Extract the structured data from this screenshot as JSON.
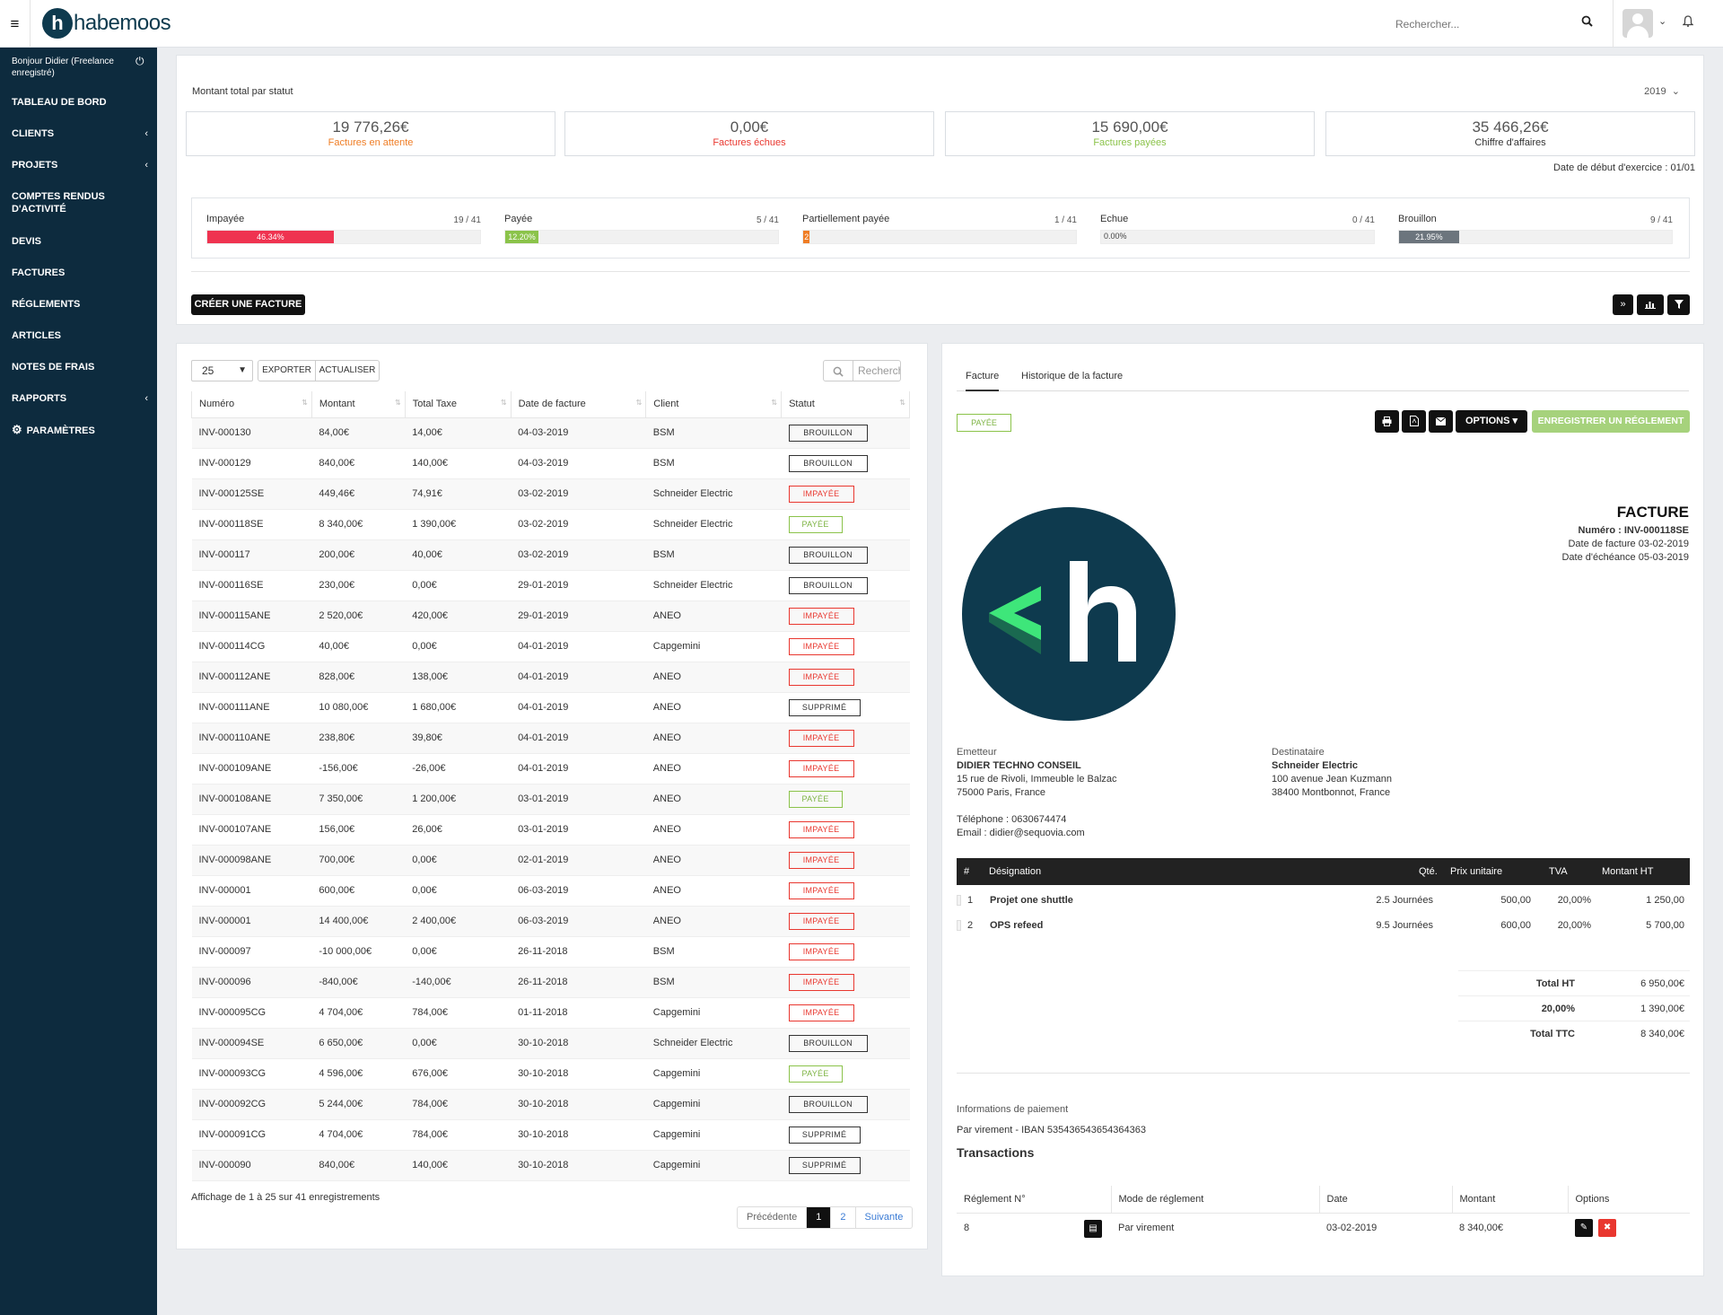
{
  "app": {
    "logo_letter": "h",
    "logo_text": "habemoos",
    "brand_color": "#0e3a4e"
  },
  "header": {
    "menu_icon": "hamburger-icon",
    "search_placeholder": "Rechercher..."
  },
  "sidebar": {
    "greeting": "Bonjour Didier (Freelance enregistré)",
    "items": [
      {
        "label": "TABLEAU DE BORD",
        "arrow": ""
      },
      {
        "label": "CLIENTS",
        "arrow": "‹"
      },
      {
        "label": "PROJETS",
        "arrow": "‹"
      },
      {
        "label": "COMPTES RENDUS D'ACTIVITÉ",
        "arrow": ""
      },
      {
        "label": "DEVIS",
        "arrow": ""
      },
      {
        "label": "FACTURES",
        "arrow": ""
      },
      {
        "label": "RÉGLEMENTS",
        "arrow": ""
      },
      {
        "label": "ARTICLES",
        "arrow": ""
      },
      {
        "label": "NOTES DE FRAIS",
        "arrow": ""
      },
      {
        "label": "RAPPORTS",
        "arrow": "‹"
      },
      {
        "label": "PARAMÈTRES",
        "arrow": ""
      }
    ]
  },
  "stats": {
    "title": "Montant total par statut",
    "year": "2019",
    "kpis": [
      {
        "value": "19 776,26€",
        "label": "Factures en attente",
        "color": "#ef7d25"
      },
      {
        "value": "0,00€",
        "label": "Factures échues",
        "color": "#e9372f"
      },
      {
        "value": "15 690,00€",
        "label": "Factures payées",
        "color": "#8bc34a"
      },
      {
        "value": "35 466,26€",
        "label": "Chiffre d'affaires",
        "color": "#333333"
      }
    ],
    "fiscal_year": "Date de début d'exercice : 01/01",
    "progress": [
      {
        "label": "Impayée",
        "count": "19 / 41",
        "pct": 46.34,
        "text": "46.34%",
        "color": "#ef3350"
      },
      {
        "label": "Payée",
        "count": "5 / 41",
        "pct": 12.2,
        "text": "12.20%",
        "color": "#8bc34a"
      },
      {
        "label": "Partiellement payée",
        "count": "1 / 41",
        "pct": 2.44,
        "text": "2",
        "color": "#ef7d25"
      },
      {
        "label": "Echue",
        "count": "0 / 41",
        "pct": 0,
        "text": "0.00%",
        "color": "#777777"
      },
      {
        "label": "Brouillon",
        "count": "9 / 41",
        "pct": 21.95,
        "text": "21.95%",
        "color": "#6c757d"
      }
    ],
    "create_label": "CRÉER UNE FACTURE"
  },
  "list": {
    "page_size": "25",
    "export_label": "EXPORTER",
    "refresh_label": "ACTUALISER",
    "search_placeholder": "Recherche",
    "columns": [
      "Numéro",
      "Montant",
      "Total Taxe",
      "Date de facture",
      "Client",
      "Statut"
    ],
    "rows": [
      [
        "INV-000130",
        "84,00€",
        "14,00€",
        "04-03-2019",
        "BSM",
        "BROUILLON"
      ],
      [
        "INV-000129",
        "840,00€",
        "140,00€",
        "04-03-2019",
        "BSM",
        "BROUILLON"
      ],
      [
        "INV-000125SE",
        "449,46€",
        "74,91€",
        "03-02-2019",
        "Schneider Electric",
        "IMPAYÉE"
      ],
      [
        "INV-000118SE",
        "8 340,00€",
        "1 390,00€",
        "03-02-2019",
        "Schneider Electric",
        "PAYÉE"
      ],
      [
        "INV-000117",
        "200,00€",
        "40,00€",
        "03-02-2019",
        "BSM",
        "BROUILLON"
      ],
      [
        "INV-000116SE",
        "230,00€",
        "0,00€",
        "29-01-2019",
        "Schneider Electric",
        "BROUILLON"
      ],
      [
        "INV-000115ANE",
        "2 520,00€",
        "420,00€",
        "29-01-2019",
        "ANEO",
        "IMPAYÉE"
      ],
      [
        "INV-000114CG",
        "40,00€",
        "0,00€",
        "04-01-2019",
        "Capgemini",
        "IMPAYÉE"
      ],
      [
        "INV-000112ANE",
        "828,00€",
        "138,00€",
        "04-01-2019",
        "ANEO",
        "IMPAYÉE"
      ],
      [
        "INV-000111ANE",
        "10 080,00€",
        "1 680,00€",
        "04-01-2019",
        "ANEO",
        "SUPPRIMÉ"
      ],
      [
        "INV-000110ANE",
        "238,80€",
        "39,80€",
        "04-01-2019",
        "ANEO",
        "IMPAYÉE"
      ],
      [
        "INV-000109ANE",
        "-156,00€",
        "-26,00€",
        "04-01-2019",
        "ANEO",
        "IMPAYÉE"
      ],
      [
        "INV-000108ANE",
        "7 350,00€",
        "1 200,00€",
        "03-01-2019",
        "ANEO",
        "PAYÉE"
      ],
      [
        "INV-000107ANE",
        "156,00€",
        "26,00€",
        "03-01-2019",
        "ANEO",
        "IMPAYÉE"
      ],
      [
        "INV-000098ANE",
        "700,00€",
        "0,00€",
        "02-01-2019",
        "ANEO",
        "IMPAYÉE"
      ],
      [
        "INV-000001",
        "600,00€",
        "0,00€",
        "06-03-2019",
        "ANEO",
        "IMPAYÉE"
      ],
      [
        "INV-000001",
        "14 400,00€",
        "2 400,00€",
        "06-03-2019",
        "ANEO",
        "IMPAYÉE"
      ],
      [
        "INV-000097",
        "-10 000,00€",
        "0,00€",
        "26-11-2018",
        "BSM",
        "IMPAYÉE"
      ],
      [
        "INV-000096",
        "-840,00€",
        "-140,00€",
        "26-11-2018",
        "BSM",
        "IMPAYÉE"
      ],
      [
        "INV-000095CG",
        "4 704,00€",
        "784,00€",
        "01-11-2018",
        "Capgemini",
        "IMPAYÉE"
      ],
      [
        "INV-000094SE",
        "6 650,00€",
        "0,00€",
        "30-10-2018",
        "Schneider Electric",
        "BROUILLON"
      ],
      [
        "INV-000093CG",
        "4 596,00€",
        "676,00€",
        "30-10-2018",
        "Capgemini",
        "PAYÉE"
      ],
      [
        "INV-000092CG",
        "5 244,00€",
        "784,00€",
        "30-10-2018",
        "Capgemini",
        "BROUILLON"
      ],
      [
        "INV-000091CG",
        "4 704,00€",
        "784,00€",
        "30-10-2018",
        "Capgemini",
        "SUPPRIMÉ"
      ],
      [
        "INV-000090",
        "840,00€",
        "140,00€",
        "30-10-2018",
        "Capgemini",
        "SUPPRIMÉ"
      ]
    ],
    "info": "Affichage de 1 à 25 sur 41 enregistrements",
    "pager": {
      "prev": "Précédente",
      "current": "1",
      "page2": "2",
      "next": "Suivante"
    }
  },
  "invoice": {
    "tabs": [
      "Facture",
      "Historique de la facture"
    ],
    "status": "PAYÉE",
    "options_label": "OPTIONS ▾",
    "register_label": "ENREGISTRER UN RÉGLEMENT",
    "title": "FACTURE",
    "number": "Numéro : INV-000118SE",
    "date": "Date de facture 03-02-2019",
    "due": "Date d'échéance 05-03-2019",
    "issuer": {
      "heading": "Emetteur",
      "name": "DIDIER TECHNO CONSEIL",
      "addr1": "15 rue de Rivoli, Immeuble le Balzac",
      "addr2": "75000 Paris, France",
      "phone": "Téléphone : 0630674474",
      "email": "Email : didier@sequovia.com"
    },
    "recipient": {
      "heading": "Destinataire",
      "name": "Schneider Electric",
      "addr1": "100 avenue Jean Kuzmann",
      "addr2": "38400 Montbonnot, France"
    },
    "item_cols": [
      "#",
      "Désignation",
      "Qté.",
      "Prix unitaire",
      "TVA",
      "Montant HT"
    ],
    "items": [
      {
        "n": "1",
        "name": "Projet one shuttle",
        "qty": "2.5 Journées",
        "price": "500,00",
        "vat": "20,00%",
        "amount": "1 250,00"
      },
      {
        "n": "2",
        "name": "OPS refeed",
        "qty": "9.5 Journées",
        "price": "600,00",
        "vat": "20,00%",
        "amount": "5 700,00"
      }
    ],
    "totals": [
      {
        "k": "Total HT",
        "v": "6 950,00€"
      },
      {
        "k": "20,00%",
        "v": "1 390,00€"
      },
      {
        "k": "Total TTC",
        "v": "8 340,00€"
      }
    ],
    "payment_heading": "Informations de paiement",
    "payment_value": "Par virement - IBAN 535436543654364363",
    "transactions_heading": "Transactions",
    "tx_cols": [
      "Réglement N°",
      "Mode de réglement",
      "Date",
      "Montant",
      "Options"
    ],
    "tx": {
      "n": "8",
      "mode": "Par virement",
      "date": "03-02-2019",
      "amount": "8 340,00€"
    }
  }
}
